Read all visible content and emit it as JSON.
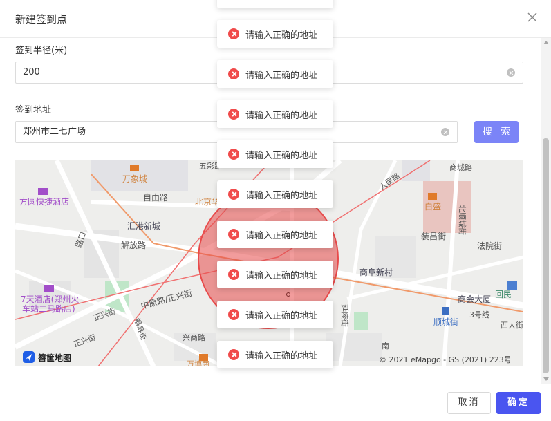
{
  "dialog": {
    "title": "新建签到点",
    "close_icon": "close-icon"
  },
  "form": {
    "radius_label": "签到半径(米)",
    "radius_value": "200",
    "address_label": "签到地址",
    "address_value": "郑州市二七广场",
    "search_label": "搜 索"
  },
  "map": {
    "labels": {
      "wanxiangcheng": "万象城",
      "fangyuan_hotel": "方圆快捷酒店",
      "huigang": "汇港新城",
      "ziyoulu": "自由路",
      "beijinghua": "北京华",
      "wucailu": "五彩路",
      "jiefanglu": "解放路",
      "lukou": "路口",
      "hotel7": "7天酒店(郑州火",
      "hotel7b": "车站二马路店)",
      "zhongyuanlu": "中原路/正兴街",
      "zhengxingjie": "正兴街",
      "zhengxingjie2": "正兴街",
      "fushoujie": "福寿街",
      "xingshanglu": "兴商路",
      "baisheng": "白盛",
      "renminlu": "人民路",
      "chenglu": "商城路",
      "beishunchengjie": "北顺城街",
      "zhuangchangjie": "装昌街",
      "fayuanjie": "法院街",
      "shangfuxincun": "商阜新村",
      "yanlingjie": "延陵街",
      "shanghuidasha": "商会大厦",
      "shunchengjie": "顺城街",
      "line3": "3号线",
      "xidajie": "西大街",
      "huimin": "回民",
      "nan": "南",
      "wanbo": "万博商",
      "brand": "簪筐地图",
      "copyright": "© 2021 eMapgo - GS (2021) 223号"
    }
  },
  "toasts": [
    "请输入正确的地址",
    "请输入正确的地址",
    "请输入正确的地址",
    "请输入正确的地址",
    "请输入正确的地址",
    "请输入正确的地址",
    "请输入正确的地址",
    "请输入正确的地址",
    "请输入正确的地址"
  ],
  "footer": {
    "cancel_label": "取消",
    "ok_label": "确定"
  },
  "colors": {
    "primary": "#4a55f0",
    "search": "#7b84f7",
    "error": "#f04b4b",
    "circle": "#e84b4b"
  }
}
